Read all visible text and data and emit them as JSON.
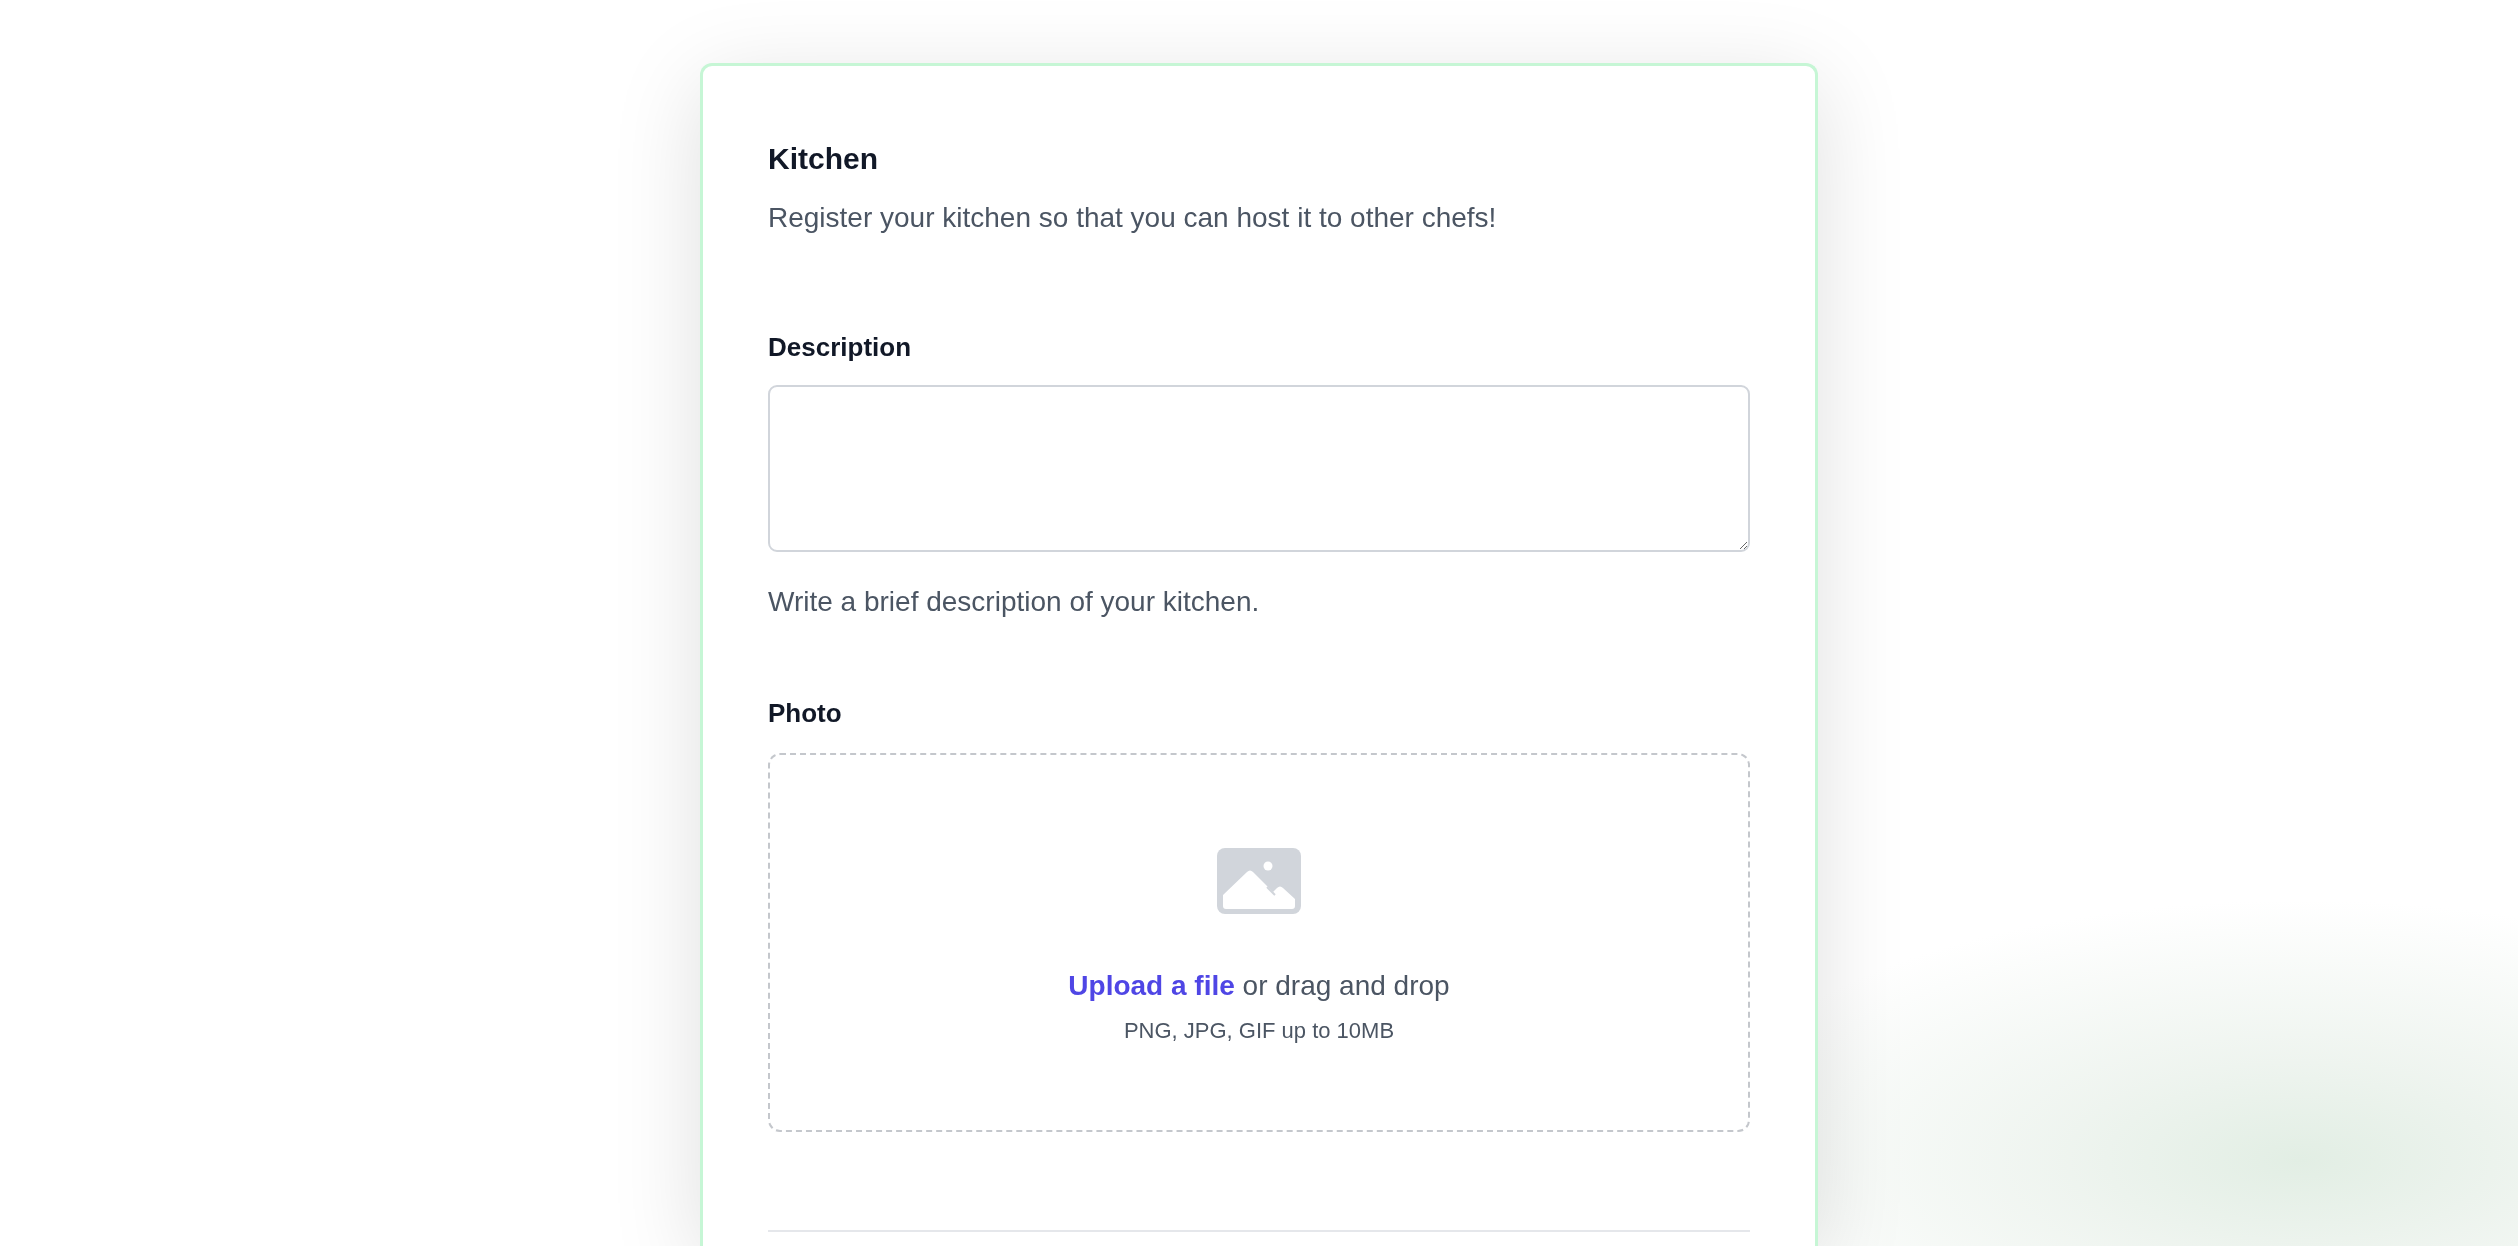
{
  "form": {
    "title": "Kitchen",
    "subtitle": "Register your kitchen so that you can host it to other chefs!",
    "fields": [
      {
        "kind": "textarea",
        "label": "Description",
        "hint": "Write a brief description of your kitchen."
      },
      {
        "kind": "file",
        "label": "Photo",
        "link": "Upload a file",
        "text": "or drag and drop",
        "note": "PNG, JPG, GIF up to 10MB"
      }
    ]
  }
}
